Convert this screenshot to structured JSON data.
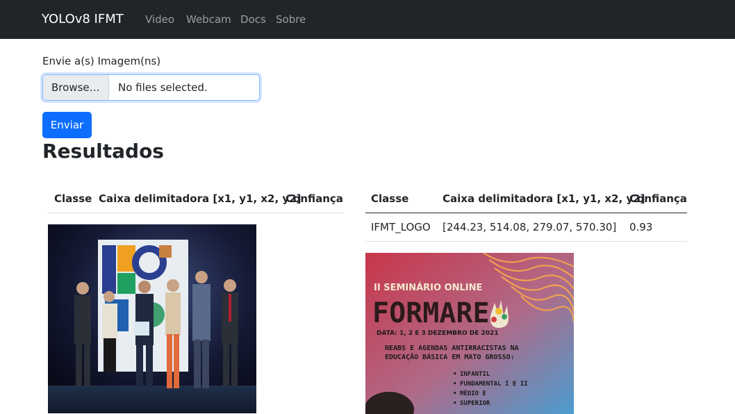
{
  "navbar": {
    "brand": "YOLOv8 IFMT",
    "links": [
      "Video",
      "Webcam",
      "Docs",
      "Sobre"
    ]
  },
  "upload": {
    "label": "Envie a(s) Imagem(ns)",
    "browse_label": "Browse…",
    "status": "No files selected.",
    "submit_label": "Enviar"
  },
  "results": {
    "heading": "Resultados",
    "tables": [
      {
        "headers": [
          "Classe",
          "Caixa delimitadora [x1, y1, x2, y2]",
          "Confiança"
        ],
        "rows": []
      },
      {
        "headers": [
          "Classe",
          "Caixa delimitadora [x1, y1, x2, y2]",
          "Confiança"
        ],
        "rows": [
          [
            "IFMT_LOGO",
            "[244.23, 514.08, 279.07, 570.30]",
            "0.93"
          ]
        ]
      }
    ],
    "poster": {
      "title_line": "II SEMINÁRIO ONLINE",
      "big_title": "FORMARE",
      "date_line": "DATA: 1, 2 E 3 DEZEMBRO DE 2021",
      "subtitle_1": "NEABS E AGENDAS ANTIRRACISTAS NA",
      "subtitle_2": "EDUCAÇÃO BÁSICA EM MATO GROSSO:",
      "bullets": [
        "INFANTIL",
        "FUNDAMENTAL I E II",
        "MÉDIO E",
        "SUPERIOR"
      ]
    }
  },
  "colors": {
    "navbar_bg": "#212529",
    "primary": "#0d6efd",
    "poster_red": "#c8364a",
    "poster_blue": "#4a9dd0"
  }
}
